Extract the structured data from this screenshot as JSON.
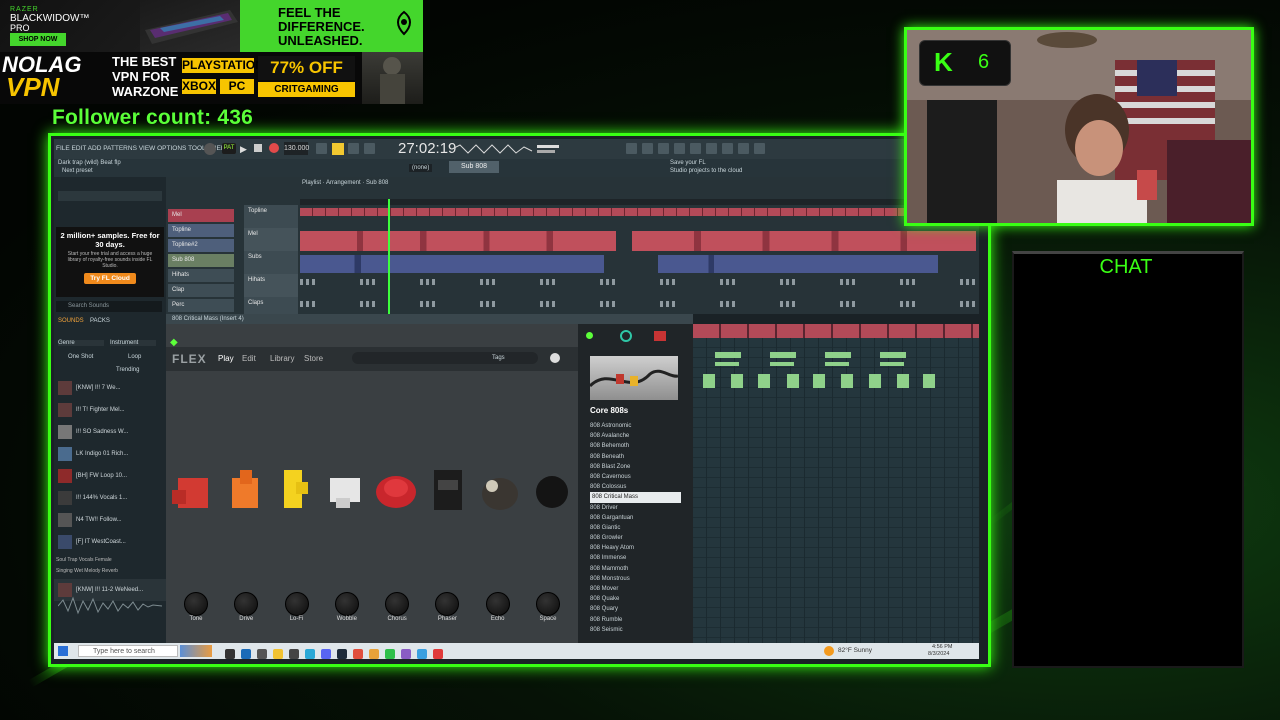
{
  "ads": {
    "razer_brand": "RAZER",
    "razer_product_line1": "BLACKWIDOW™",
    "razer_product_line2": "PRO",
    "shop_now": "SHOP NOW",
    "tagline1": "FEEL THE",
    "tagline2": "DIFFERENCE.",
    "tagline3": "UNLEASHED.",
    "nolag_line1": "NOLAG",
    "nolag_line2": "VPN",
    "best_line1": "THE BEST",
    "best_line2": "VPN FOR",
    "best_line3": "WARZONE",
    "platform1": "PLAYSTATION",
    "platform2": "XBOX",
    "platform3": "PC",
    "discount": "77% OFF",
    "code": "CRITGAMING"
  },
  "follower": {
    "text": "Follower count: 436"
  },
  "daw": {
    "menu": "FILE EDIT ADD PATTERNS VIEW OPTIONS TOOLS HELP",
    "bpm": "130.000",
    "time": "27:02:19",
    "pattern": "Sub 808",
    "hint_title": "Dark trap (wild) Beat flp",
    "hint_sub": "Next preset",
    "cloud_hint1": "Save your FL",
    "cloud_hint2": "Studio projects to the cloud",
    "snap": "(none)",
    "playlist_path": "Playlist · Arrangement · Sub 808",
    "channel_rack_title": "808 Critical Mass (Insert 4)",
    "browser": {
      "promo_title": "2 million+ samples. Free for 30 days.",
      "promo_text": "Start your free trial and access a huge library of royalty-free sounds inside FL Studio.",
      "promo_button": "Try FL Cloud",
      "search_placeholder": "Search Sounds",
      "tab_sounds": "SOUNDS",
      "tab_packs": "PACKS",
      "filter_genre": "Genre",
      "filter_instrument": "Instrument",
      "filter_oneshot": "One Shot",
      "filter_loop": "Loop",
      "sort": "Trending",
      "samples": [
        "[KNW] I!! 7 We...",
        "I!! T! Fighter Mel...",
        "I!! SO Sadness W...",
        "LK Indigo 01 Rich...",
        "[BH] FW Loop 10...",
        "I!! 144% Vocals 1...",
        "N4 TW!! Follow...",
        "[F] IT WestCoast...",
        "[KNW] I!! 11-2 WeNeed..."
      ],
      "genres": [
        "Soul",
        "Trap",
        "Vocals",
        "Female",
        "Singing",
        "Wet",
        "Melody",
        "Reverb"
      ]
    },
    "tracks": [
      "Topline",
      "Mel",
      "Subs",
      "Hihats",
      "Claps"
    ],
    "channels": [
      "Mel",
      "Topline",
      "Topline#2",
      "Sub 808",
      "Hihats",
      "Clap",
      "Perc"
    ],
    "flex": {
      "brand": "FLEX",
      "nav_play": "Play",
      "nav_edit": "Edit",
      "nav_library": "Library",
      "nav_store": "Store",
      "tags": "Tags",
      "category": "Core 808s",
      "knobs": [
        "Tone",
        "Drive",
        "Lo-Fi",
        "Wobble",
        "Chorus",
        "Phaser",
        "Echo",
        "Space"
      ],
      "presets": [
        "808 Astronomic",
        "808 Avalanche",
        "808 Behemoth",
        "808 Beneath",
        "808 Blast Zone",
        "808 Cavernous",
        "808 Colossus",
        "808 Critical Mass",
        "808 Driver",
        "808 Gargantuan",
        "808 Giantic",
        "808 Growler",
        "808 Heavy Atom",
        "808 Immense",
        "808 Mammoth",
        "808 Monstrous",
        "808 Mover",
        "808 Quake",
        "808 Quary",
        "808 Rumble",
        "808 Seismic"
      ],
      "selected_preset": "808 Critical Mass"
    },
    "taskbar": {
      "search": "Type here to search",
      "weather": "82°F Sunny",
      "time": "4:56 PM",
      "date": "8/3/2024"
    }
  },
  "cam": {
    "badge_letter": "K",
    "badge_number": "6"
  },
  "chat": {
    "title": "CHAT"
  },
  "colors": {
    "accent": "#39ff14",
    "razer_green": "#44d62c",
    "flex_bg": "#3a3f42"
  }
}
